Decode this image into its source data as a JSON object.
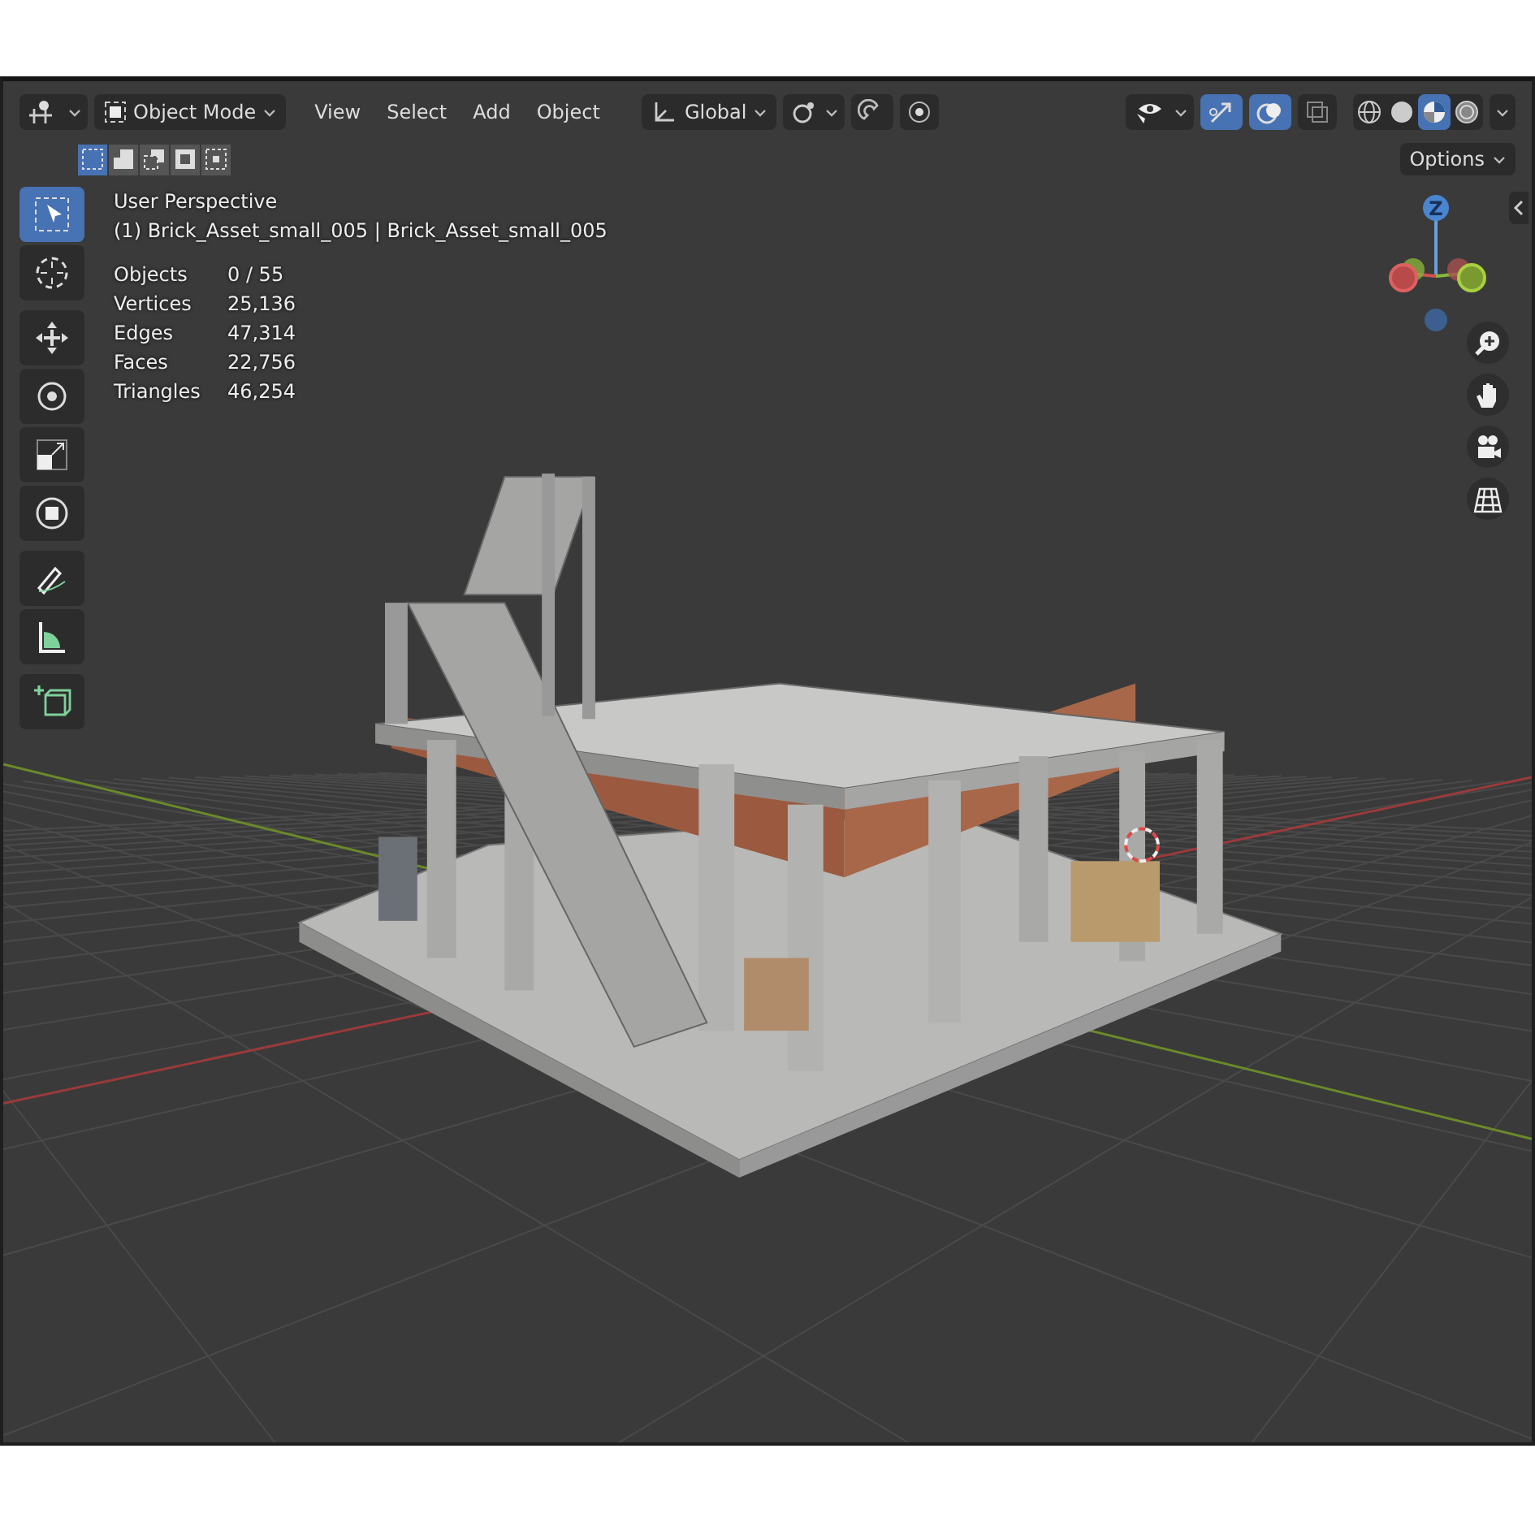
{
  "header": {
    "mode": "Object Mode",
    "menus": [
      "View",
      "Select",
      "Add",
      "Object"
    ],
    "orientation": "Global",
    "toggles": [
      {
        "kind": "snap",
        "on": false
      },
      {
        "kind": "proportional",
        "on": false
      }
    ],
    "view_toggles": [
      {
        "kind": "gizmo",
        "on": true
      },
      {
        "kind": "overlay",
        "on": true
      },
      {
        "kind": "xray",
        "on": false
      }
    ],
    "shading_modes": [
      {
        "kind": "wireframe",
        "selected": false
      },
      {
        "kind": "solid",
        "selected": false
      },
      {
        "kind": "material",
        "selected": true
      },
      {
        "kind": "rendered",
        "selected": false
      }
    ]
  },
  "select_modes": [
    {
      "kind": "set",
      "selected": true
    },
    {
      "kind": "extend",
      "selected": false
    },
    {
      "kind": "subtract",
      "selected": false
    },
    {
      "kind": "invert",
      "selected": false
    },
    {
      "kind": "intersect",
      "selected": false
    }
  ],
  "options": "Options",
  "tool_groups": [
    {
      "tools": [
        {
          "kind": "select",
          "selected": true
        },
        {
          "kind": "cursor",
          "selected": false
        }
      ]
    },
    {
      "tools": [
        {
          "kind": "move",
          "selected": false
        },
        {
          "kind": "rotate",
          "selected": false
        },
        {
          "kind": "scale",
          "selected": false
        },
        {
          "kind": "transform",
          "selected": false
        }
      ]
    },
    {
      "tools": [
        {
          "kind": "annotate",
          "selected": false
        },
        {
          "kind": "measure",
          "selected": false
        }
      ]
    },
    {
      "tools": [
        {
          "kind": "add-cube",
          "selected": false
        }
      ]
    }
  ],
  "overlay": {
    "view": "User Perspective",
    "object": "(1) Brick_Asset_small_005 | Brick_Asset_small_005"
  },
  "stats": [
    {
      "label": "Objects",
      "value": "0 / 55"
    },
    {
      "label": "Vertices",
      "value": "25,136"
    },
    {
      "label": "Edges",
      "value": "47,314"
    },
    {
      "label": "Faces",
      "value": "22,756"
    },
    {
      "label": "Triangles",
      "value": "46,254"
    }
  ],
  "gizmo": {
    "z_label": "Z"
  },
  "nav_buttons": [
    {
      "kind": "zoom"
    },
    {
      "kind": "pan"
    },
    {
      "kind": "camera"
    },
    {
      "kind": "ortho"
    }
  ]
}
